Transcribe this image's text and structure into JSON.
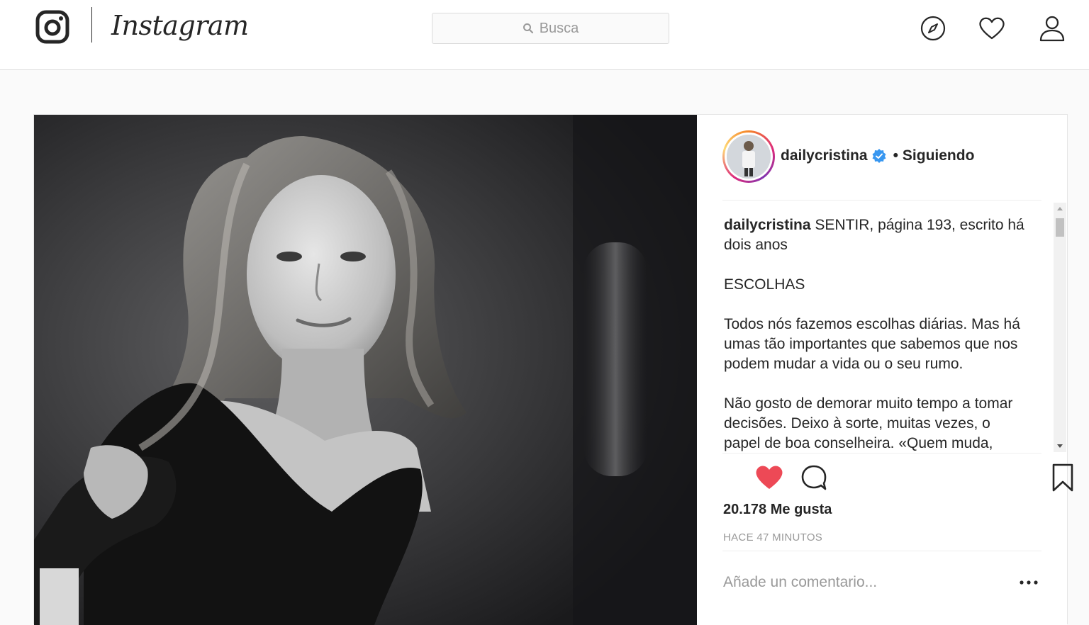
{
  "nav": {
    "brand": "Instagram",
    "search_placeholder": "Busca",
    "icons": [
      "instagram-camera-icon",
      "explore-compass-icon",
      "activity-heart-icon",
      "profile-user-icon"
    ]
  },
  "post": {
    "username": "dailycristina",
    "verified": true,
    "follow_separator": "•",
    "follow_status": "Siguiendo",
    "caption_user": "dailycristina",
    "caption_body": " SENTIR, página 193, escrito há dois anos\n\nESCOLHAS\n\nTodos nós fazemos escolhas diárias. Mas há umas tão importantes que sabemos que nos podem mudar a vida ou o seu rumo.\n\nNão gosto de demorar muito tempo a tomar decisões. Deixo à sorte, muitas vezes, o papel de boa conselheira. «Quem muda,",
    "likes": "20.178 Me gusta",
    "timestamp": "HACE 47 MINUTOS",
    "comment_placeholder": "Añade un comentario...",
    "liked": true,
    "icons": [
      "like-heart-icon",
      "comment-bubble-icon",
      "save-bookmark-icon",
      "more-options-icon"
    ]
  },
  "colors": {
    "like_red": "#ed4956",
    "verified_blue": "#3897f0",
    "border": "#dbdbdb",
    "muted_text": "#999999"
  }
}
